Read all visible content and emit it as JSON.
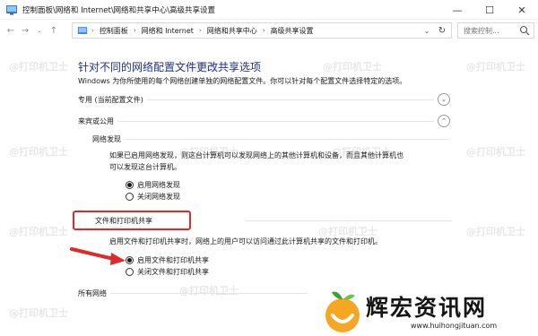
{
  "window": {
    "title": "控制面板\\网络和 Internet\\网络和共享中心\\高级共享设置",
    "minimize_glyph": "—",
    "maximize_glyph": "☐",
    "close_glyph": "✕"
  },
  "address": {
    "crumbs": [
      "控制面板",
      "网络和 Internet",
      "网络和共享中心",
      "高级共享设置"
    ],
    "search_placeholder": "搜索控制..."
  },
  "main": {
    "title": "针对不同的网络配置文件更改共享选项",
    "description": "Windows 为你所使用的每个网络创建单独的网络配置文件。你可以针对每个配置文件选择特定的选项。",
    "profiles": {
      "private": {
        "label": "专用 (当前配置文件)",
        "expanded": false
      },
      "guest": {
        "label": "来宾或公用",
        "expanded": true,
        "discovery": {
          "heading": "网络发现",
          "text_line1": "如果已启用网络发现，则这台计算机可以发现网络上的其他计算机和设备，而且其他计算机也",
          "text_line2": "可以发现这台计算机。",
          "options": [
            {
              "label": "启用网络发现",
              "checked": true
            },
            {
              "label": "关闭网络发现",
              "checked": false
            }
          ]
        },
        "sharing": {
          "heading": "文件和打印机共享",
          "text": "启用文件和打印机共享时，网络上的用户可以访问通过此计算机共享的文件和打印机。",
          "options": [
            {
              "label": "启用文件和打印机共享",
              "checked": true
            },
            {
              "label": "关闭文件和打印机共享",
              "checked": false
            }
          ]
        }
      },
      "all": {
        "label": "所有网络"
      }
    }
  },
  "watermark": {
    "text": "@打印机卫士"
  },
  "logo": {
    "text": "辉宏资讯网",
    "url": "www.huihongjituan.com"
  },
  "colors": {
    "title": "#1e3287",
    "highlight": "#e02a2a",
    "arrow": "#e02a2a"
  }
}
